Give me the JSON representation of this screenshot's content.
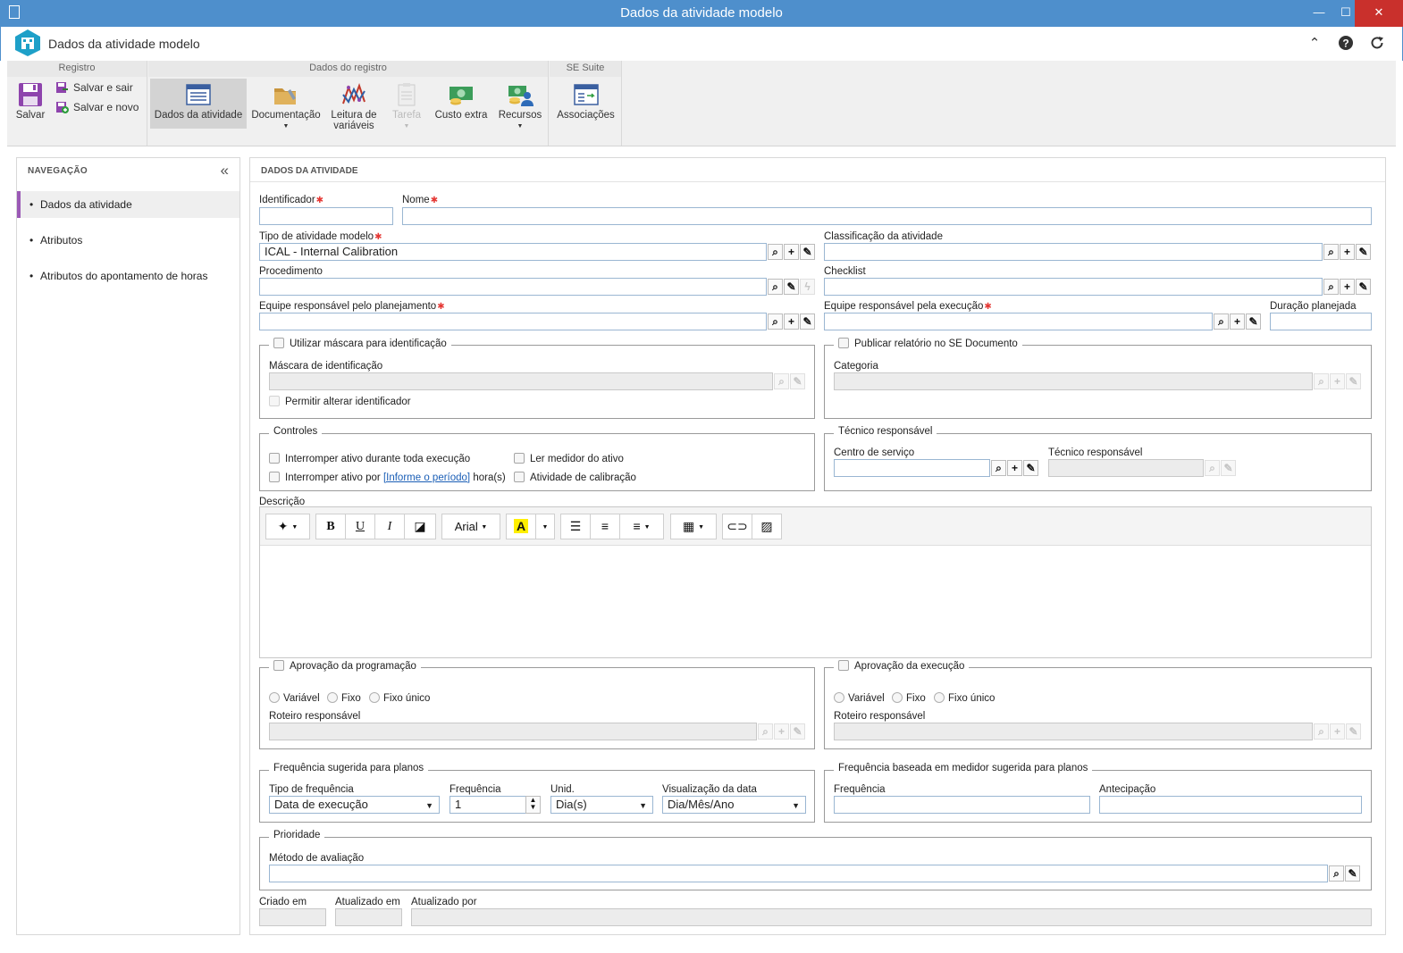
{
  "window": {
    "title": "Dados da atividade modelo",
    "minimize": "—",
    "maximize": "☐",
    "close": "✕"
  },
  "header": {
    "title": "Dados da atividade modelo",
    "icons": [
      "collapse-up-icon",
      "help-icon",
      "refresh-icon"
    ]
  },
  "ribbon": {
    "groups": {
      "registro": "Registro",
      "dados_registro": "Dados do registro",
      "se_suite": "SE Suite"
    },
    "save": "Salvar",
    "save_exit": "Salvar e sair",
    "save_new": "Salvar e novo",
    "dados_atividade": "Dados da atividade",
    "documentacao": "Documentação",
    "leitura_1": "Leitura de",
    "leitura_2": "variáveis",
    "tarefa": "Tarefa",
    "custo_extra": "Custo extra",
    "recursos": "Recursos",
    "associacoes": "Associações"
  },
  "nav": {
    "title": "NAVEGAÇÃO",
    "items": [
      "Dados da atividade",
      "Atributos",
      "Atributos do apontamento de horas"
    ],
    "active_index": 0
  },
  "main": {
    "title": "DADOS DA ATIVIDADE",
    "identificador": {
      "label": "Identificador",
      "value": ""
    },
    "nome": {
      "label": "Nome",
      "value": ""
    },
    "tipo": {
      "label": "Tipo de atividade modelo",
      "value": "ICAL - Internal Calibration"
    },
    "classificacao": {
      "label": "Classificação da atividade",
      "value": ""
    },
    "procedimento": {
      "label": "Procedimento",
      "value": ""
    },
    "checklist": {
      "label": "Checklist",
      "value": ""
    },
    "equipe_planejamento": {
      "label": "Equipe responsável pelo planejamento",
      "value": ""
    },
    "equipe_execucao": {
      "label": "Equipe responsável pela execução",
      "value": ""
    },
    "duracao": {
      "label": "Duração planejada",
      "value": ""
    },
    "mascara": {
      "legend": "Utilizar máscara para identificação",
      "field_label": "Máscara de identificação",
      "permitir": "Permitir alterar identificador"
    },
    "publicar": {
      "legend": "Publicar relatório no SE Documento",
      "categoria": "Categoria"
    },
    "controles": {
      "legend": "Controles",
      "interromper_toda": "Interromper ativo durante toda execução",
      "interromper_por": "Interromper ativo por",
      "informe_periodo": "[Informe o período]",
      "horas": "hora(s)",
      "ler_medidor": "Ler medidor do ativo",
      "atividade_calibracao": "Atividade de calibração"
    },
    "tecnico": {
      "legend": "Técnico responsável",
      "centro": "Centro de serviço",
      "tecnico": "Técnico responsável"
    },
    "descricao": {
      "label": "Descrição",
      "font": "Arial"
    },
    "aprov_prog": {
      "legend": "Aprovação da programação",
      "opts": [
        "Variável",
        "Fixo",
        "Fixo único"
      ],
      "roteiro": "Roteiro responsável"
    },
    "aprov_exec": {
      "legend": "Aprovação da execução",
      "opts": [
        "Variável",
        "Fixo",
        "Fixo único"
      ],
      "roteiro": "Roteiro responsável"
    },
    "freq": {
      "legend": "Frequência sugerida para planos",
      "tipo_label": "Tipo de frequência",
      "tipo_value": "Data de execução",
      "freq_label": "Frequência",
      "freq_value": "1",
      "unid_label": "Unid.",
      "unid_value": "Dia(s)",
      "vis_label": "Visualização da data",
      "vis_value": "Dia/Mês/Ano"
    },
    "freq_medidor": {
      "legend": "Frequência baseada em medidor sugerida para planos",
      "freq_label": "Frequência",
      "antecip_label": "Antecipação"
    },
    "prioridade": {
      "legend": "Prioridade",
      "metodo": "Método de avaliação"
    },
    "criado_em": "Criado em",
    "atualizado_em": "Atualizado em",
    "atualizado_por": "Atualizado por"
  }
}
